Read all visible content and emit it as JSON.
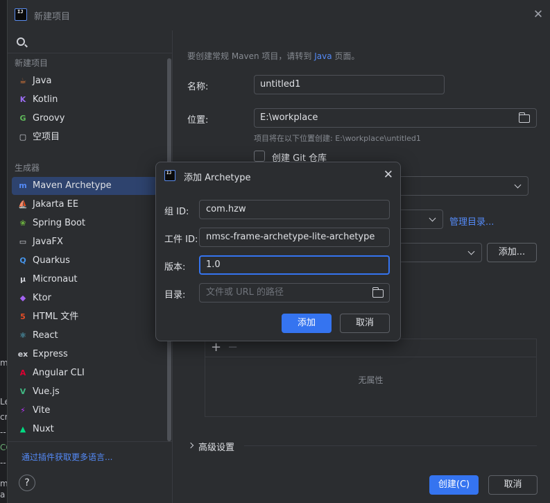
{
  "window": {
    "title": "新建项目",
    "logo_text": "IJ"
  },
  "sidebar": {
    "section_new": "新建项目",
    "new_items": [
      {
        "label": "Java",
        "icon": "java-icon",
        "color": "#e57c3a"
      },
      {
        "label": "Kotlin",
        "icon": "kotlin-icon",
        "color": "#9a6cf0"
      },
      {
        "label": "Groovy",
        "icon": "groovy-icon",
        "color": "#5fb85a"
      },
      {
        "label": "空项目",
        "icon": "empty-project-icon",
        "color": "#ced0d6"
      }
    ],
    "section_generators": "生成器",
    "generator_items": [
      {
        "label": "Maven Archetype",
        "icon": "maven-icon",
        "color": "#548af7",
        "selected": true
      },
      {
        "label": "Jakarta EE",
        "icon": "jakarta-icon",
        "color": "#e8a33d"
      },
      {
        "label": "Spring Boot",
        "icon": "spring-icon",
        "color": "#6db33f"
      },
      {
        "label": "JavaFX",
        "icon": "javafx-icon",
        "color": "#ced0d6"
      },
      {
        "label": "Quarkus",
        "icon": "quarkus-icon",
        "color": "#4695eb"
      },
      {
        "label": "Micronaut",
        "icon": "micronaut-icon",
        "color": "#ced0d6"
      },
      {
        "label": "Ktor",
        "icon": "ktor-icon",
        "color": "#a463f2"
      },
      {
        "label": "HTML 文件",
        "icon": "html-icon",
        "color": "#e44d26"
      },
      {
        "label": "React",
        "icon": "react-icon",
        "color": "#61dafb"
      },
      {
        "label": "Express",
        "icon": "express-icon",
        "color": "#ced0d6"
      },
      {
        "label": "Angular CLI",
        "icon": "angular-icon",
        "color": "#dd0031"
      },
      {
        "label": "Vue.js",
        "icon": "vue-icon",
        "color": "#41b883"
      },
      {
        "label": "Vite",
        "icon": "vite-icon",
        "color": "#bd34fe"
      },
      {
        "label": "Nuxt",
        "icon": "nuxt-icon",
        "color": "#00dc82"
      }
    ],
    "plugin_link": "通过插件获取更多语言...",
    "help": "?"
  },
  "main": {
    "hint_prefix": "要创建常规 Maven 项目，请转到 ",
    "hint_link": "Java",
    "hint_suffix": " 页面。",
    "name_label": "名称:",
    "name_value": "untitled1",
    "location_label": "位置:",
    "location_value": "E:\\workplace",
    "location_hint": "项目将在以下位置创建: E:\\workplace\\untitled1",
    "git_label": "创建 Git 仓库",
    "manage_catalogs": "管理目录...",
    "add_button": "添加...",
    "no_properties": "无属性",
    "plus": "+",
    "minus": "−",
    "advanced": "高级设置",
    "create_button": "创建(C)",
    "cancel_button": "取消"
  },
  "dialog": {
    "title": "添加 Archetype",
    "logo_text": "IJ",
    "group_label": "组 ID:",
    "group_value": "com.hzw",
    "artifact_label": "工件 ID:",
    "artifact_value": "nmsc-frame-archetype-lite-archetype",
    "version_label": "版本:",
    "version_value": "1.0",
    "catalog_label": "目录:",
    "catalog_placeholder": "文件或 URL 的路径",
    "add_button": "添加",
    "cancel_button": "取消"
  },
  "background": {
    "fragments": [
      "m",
      "Le",
      "cr",
      "--",
      "CO",
      "--",
      "e",
      "me",
      "a"
    ]
  },
  "colors": {
    "accent": "#3574f0",
    "link": "#548af7",
    "selected": "#2e436e",
    "panel": "#2b2d30"
  }
}
